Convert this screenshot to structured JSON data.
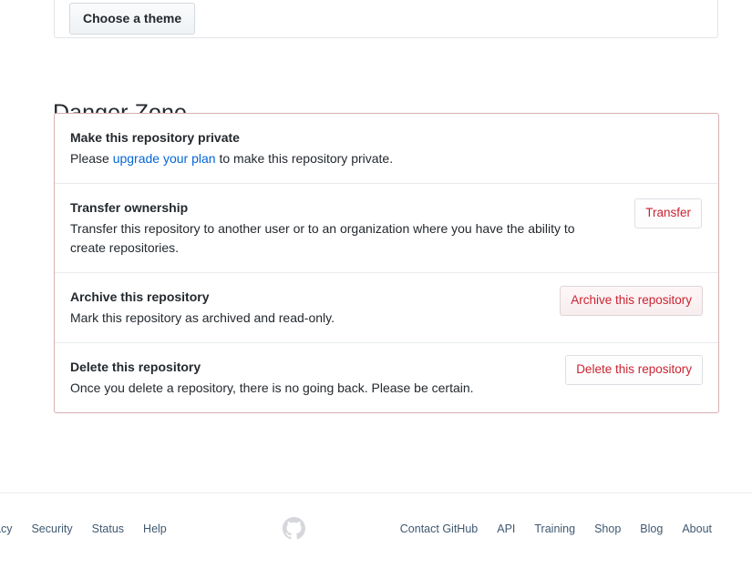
{
  "top_panel": {
    "theme_button_label": "Choose a theme"
  },
  "danger_zone": {
    "heading": "Danger Zone",
    "border_color": "#d9aeb3",
    "danger_text_color": "#cb2431",
    "link_color": "#0366d6",
    "rows": [
      {
        "title": "Make this repository private",
        "desc_before": "Please ",
        "desc_link": "upgrade your plan",
        "desc_after": " to make this repository private.",
        "button": null
      },
      {
        "title": "Transfer ownership",
        "desc": "Transfer this repository to another user or to an organization where you have the ability to create repositories.",
        "button": "Transfer"
      },
      {
        "title": "Archive this repository",
        "desc": "Mark this repository as archived and read-only.",
        "button": "Archive this repository"
      },
      {
        "title": "Delete this repository",
        "desc": "Once you delete a repository, there is no going back. Please be certain.",
        "button": "Delete this repository"
      }
    ]
  },
  "footer": {
    "left_links": [
      "acy",
      "Security",
      "Status",
      "Help"
    ],
    "right_links": [
      "Contact GitHub",
      "API",
      "Training",
      "Shop",
      "Blog",
      "About"
    ],
    "logo": "github-mark-icon",
    "link_color": "#3f5871"
  }
}
